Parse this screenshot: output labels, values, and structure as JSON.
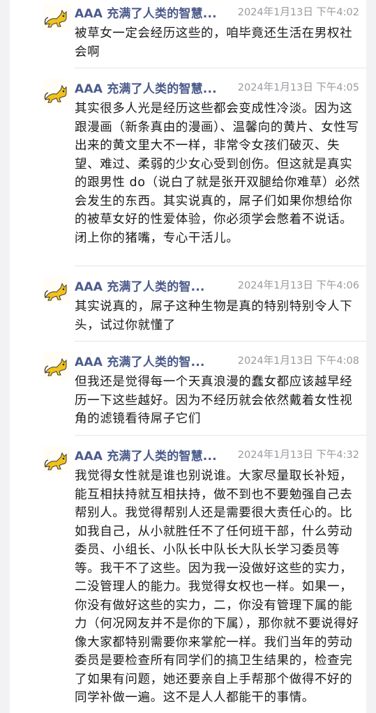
{
  "messages": [
    {
      "author": "AAA 充满了人类的智慧...",
      "time": "2024年1月13日 下午4:02",
      "text": "被草女一定会经历这些的，咱毕竟还生活在男权社会啊"
    },
    {
      "author": "AAA 充满了人类的智慧...",
      "time": "2024年1月13日 下午4:05",
      "text": "其实很多人光是经历这些都会变成性冷淡。因为这跟漫画（新条真由的漫画）、温馨向的黄片、女性写出来的黄文里大不一样，非常令女孩们破灭、失望、难过、柔弱的少女心受到创伤。但这就是真实的跟男性 do（说白了就是张开双腿给你难草）必然会发生的东西。其实说真的，屌子们如果你想给你的被草女好的性爱体验，你必须学会憋着不说话。闭上你的猪嘴，专心干活儿。"
    },
    {
      "author": "AAA 充满了人类的智...",
      "time": "2024年1月13日 下午4:06",
      "text": "其实说真的，屌子这种生物是真的特别特别令人下头，试过你就懂了"
    },
    {
      "author": "AAA 充满了人类的智...",
      "time": "2024年1月13日 下午4:08",
      "text": "但我还是觉得每一个天真浪漫的蠢女都应该越早经历一下这些越好。因为不经历就会依然戴着女性视角的滤镜看待屌子它们"
    },
    {
      "author": "AAA 充满了人类的智慧...",
      "time": "2024年1月13日 下午4:32",
      "text": "我觉得女性就是谁也别说谁。大家尽量取长补短，能互相扶持就互相扶持，做不到也不要勉强自己去帮别人。我觉得帮别人还是需要很大责任心的。比如我自己，从小就胜任不了任何班干部，什么劳动委员、小组长、小队长中队长大队长学习委员等等。我干不了这些。因为我一没做好这些的实力，二没管理人的能力。我觉得女权也一样。如果一，你没有做好这些的实力，二，你没有管理下属的能力（何况网友并不是你的下属），那你就不要说得好像大家都特别需要你来掌舵一样。我们当年的劳动委员是要检查所有同学们的搞卫生结果的，检查完了如果有问题，她还要亲自上手帮那个做得不好的同学补做一遍。这不是人人都能干的事情。"
    }
  ]
}
